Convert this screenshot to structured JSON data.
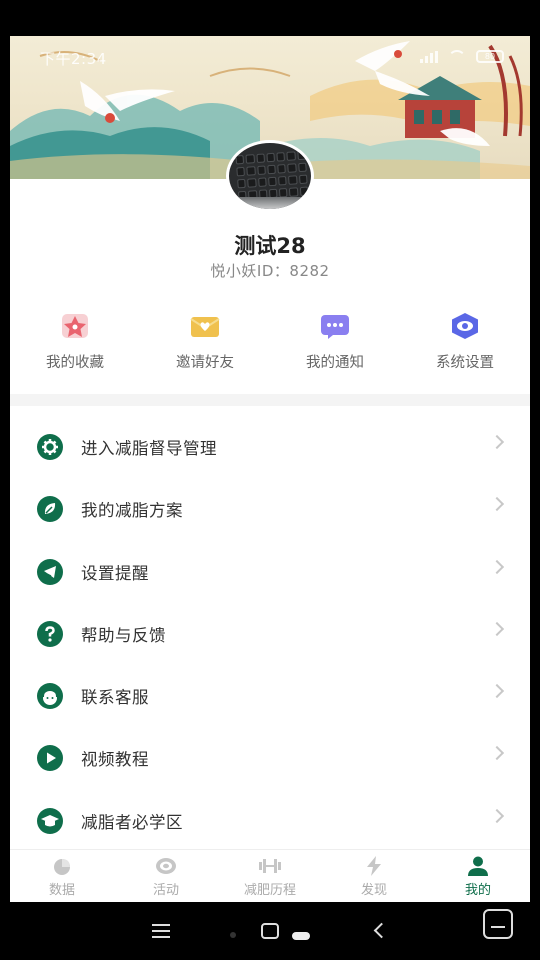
{
  "status": {
    "time": "下午2:34",
    "battery": "80"
  },
  "profile": {
    "name": "测试28",
    "id_text": "悦小妖ID：8282"
  },
  "quick_actions": [
    {
      "label": "我的收藏",
      "icon": "star-icon",
      "color": "#e9646f"
    },
    {
      "label": "邀请好友",
      "icon": "envelope-heart-icon",
      "color": "#f0c14e"
    },
    {
      "label": "我的通知",
      "icon": "message-icon",
      "color": "#8a7ff0"
    },
    {
      "label": "系统设置",
      "icon": "eye-settings-icon",
      "color": "#5a67e6"
    }
  ],
  "menu": [
    {
      "label": "进入减脂督导管理",
      "icon": "gear-icon"
    },
    {
      "label": "我的减脂方案",
      "icon": "leaf-icon"
    },
    {
      "label": "设置提醒",
      "icon": "bell-icon"
    },
    {
      "label": "帮助与反馈",
      "icon": "question-icon"
    },
    {
      "label": "联系客服",
      "icon": "customer-service-icon"
    },
    {
      "label": "视频教程",
      "icon": "play-icon"
    },
    {
      "label": "减脂者必学区",
      "icon": "graduation-cap-icon"
    }
  ],
  "tabs": [
    {
      "label": "数据",
      "icon": "pie-chart-icon",
      "active": false
    },
    {
      "label": "活动",
      "icon": "target-icon",
      "active": false
    },
    {
      "label": "减肥历程",
      "icon": "dumbbell-icon",
      "active": false
    },
    {
      "label": "发现",
      "icon": "lightning-icon",
      "active": false
    },
    {
      "label": "我的",
      "icon": "person-icon",
      "active": true
    }
  ],
  "colors": {
    "accent": "#0f6e4b",
    "inactive": "#aaaaaa"
  }
}
